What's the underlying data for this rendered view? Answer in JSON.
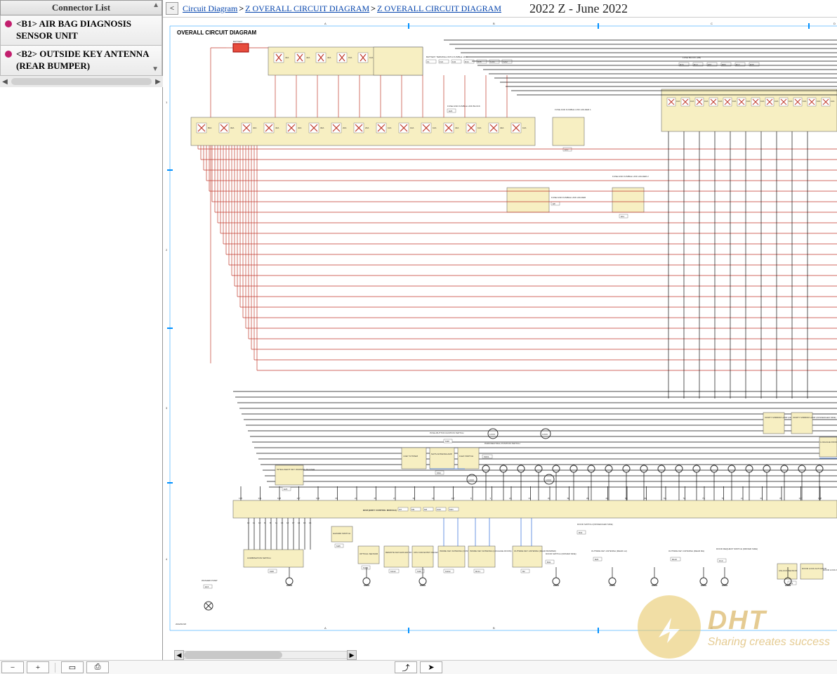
{
  "sidebar": {
    "header": "Connector List",
    "items": [
      {
        "code": "<B1>",
        "text": "AIR BAG DIAGNOSIS SENSOR UNIT"
      },
      {
        "code": "<B2>",
        "text": "OUTSIDE KEY ANTENNA (REAR BUMPER)"
      }
    ]
  },
  "breadcrumb": {
    "back": "<",
    "items": [
      "Circuit Diagram",
      "Z OVERALL CIRCUIT DIAGRAM",
      "Z OVERALL CIRCUIT DIAGRAM"
    ],
    "sep": ">"
  },
  "doc_title": "2022 Z - June 2022",
  "diagram": {
    "title": "OVERALL CIRCUIT DIAGRAM",
    "date": "2022/02/18",
    "grid_cols": [
      "A",
      "B",
      "C",
      "D"
    ],
    "grid_rows": [
      "1",
      "2",
      "3",
      "4"
    ],
    "battery_label": "BATTERY",
    "blocks": {
      "batt_terminal": {
        "label": "BATTERY TERMINAL WITH FUSIBLE LINK",
        "refs": [
          "F1",
          "F21",
          "F22",
          "R44",
          "R45",
          "F221",
          "F222"
        ]
      },
      "fuse_block_jb": {
        "label": "FUSE BLOCK (J/B)",
        "refs": [
          "R16",
          "R13",
          "E67",
          "R80",
          "R17",
          "R35"
        ]
      },
      "fuse_fusible_block": {
        "label": "FUSE AND FUSIBLE LINK BLOCK",
        "refs": [
          "E24"
        ]
      },
      "fuse_holder1": {
        "label": "FUSE AND FUSIBLE LINK HOLDER 1",
        "refs": [
          "E10"
        ]
      },
      "fuse_holder_a": {
        "label": "FUSE AND FUSIBLE LINK HOLDER",
        "refs": [
          "E8"
        ]
      },
      "fuse_holder2": {
        "label": "FUSE AND FUSIBLE LINK HOLDER 2",
        "refs": [
          "E11"
        ]
      },
      "ikey_warning": {
        "label": "INTELLIGENT KEY WARNING BUZZER",
        "refs": [
          "E23"
        ]
      },
      "ikey_system": {
        "label": "I-KEY SYSTEM",
        "refs": [
          "M36"
        ]
      },
      "nats_antenna": {
        "label": "NATS ANTENNA AMP.",
        "refs": [
          "M34"
        ]
      },
      "flexswitch": {
        "label": "FLEX SWITCH",
        "refs": [
          "M201"
        ]
      },
      "push_button": {
        "label": "PUSH-BUTTON IGNITION SWITCH",
        "refs": [
          "M38"
        ]
      },
      "park_neutral": {
        "label": "PARK/NEUTRAL POSITION SWITCH",
        "refs": [
          "E37"
        ]
      },
      "vanity_driver": {
        "label": "VANITY MIRROR LAMP (DRIVER SIDE)",
        "refs": [
          "R81"
        ]
      },
      "vanity_pass": {
        "label": "VANITY MIRROR LAMP (PASSENGER SIDE)",
        "refs": [
          "R82"
        ]
      },
      "luggage_lamp": {
        "label": "LUGGAGE ROOM LAMP",
        "refs": [
          "R41"
        ]
      },
      "bcm": {
        "label": "BCM (BODY CONTROL MODULE)",
        "refs": [
          "M7",
          "M9",
          "M6",
          "M19",
          "M21"
        ]
      },
      "door_sw_pass": {
        "label": "DOOR SWITCH (PASSENGER SIDE)",
        "refs": [
          "B33"
        ]
      },
      "hazard_switch": {
        "label": "HAZARD SWITCH",
        "refs": [
          "M45"
        ]
      },
      "combination_switch": {
        "label": "COMBINATION SWITCH",
        "refs": [
          "M28"
        ]
      },
      "washer_pump": {
        "label": "WASHER PUMP",
        "refs": [
          "E16"
        ]
      },
      "remote_keyless": {
        "label": "REMOTE KEYLESS ENTRY RECEIVER",
        "refs": [
          "M142"
        ]
      },
      "optical_sensor": {
        "label": "OPTICAL SENSOR",
        "refs": [
          "M112"
        ]
      },
      "cpu_rke": {
        "label": "CPU FOR ENTRY RECEIVER",
        "refs": [
          "M48"
        ]
      },
      "inside_key_console": {
        "label": "INSIDE KEY ANTENNA (CONSOLE)",
        "refs": [
          "M102"
        ]
      },
      "inside_key_luggage": {
        "label": "INSIDE KEY ANTENNA (LUGGAGE ROOM)",
        "refs": [
          "B131"
        ]
      },
      "outside_key_rear": {
        "label": "OUTSIDE KEY ANTENNA (REAR BUMPER)",
        "refs": [
          "B2"
        ]
      },
      "door_sw_driver": {
        "label": "DOOR SWITCH (DRIVER SIDE)",
        "refs": [
          "B34"
        ]
      },
      "outside_key_rearlh": {
        "label": "OUTSIDE KEY ANTENNA (REAR LH)",
        "refs": [
          "B26"
        ]
      },
      "outside_key_rearrh": {
        "label": "OUTSIDE KEY ANTENNA (REAR RH)",
        "refs": [
          "B120"
        ]
      },
      "door_request_driver": {
        "label": "DOOR REQUEST SWITCH (DRIVER SIDE)",
        "refs": [
          "D10"
        ]
      },
      "unlock_sensor": {
        "label": "UNLOCK SENSOR",
        "refs": [
          "D33"
        ]
      },
      "door_lock_actuator": {
        "label": "DOOR LOCK ACTUATOR",
        "refs": []
      },
      "door_lock_assembly": {
        "label": "DOOR LOCK ASSEMBLY",
        "refs": [
          "D11"
        ]
      }
    },
    "fuse_values_top": [
      "40A",
      "40A",
      "40A",
      "15A",
      "10A",
      "40A",
      "40A"
    ],
    "fuse_values_top2": [
      "10A",
      "40A"
    ],
    "fuse_values_jb": [
      "10A",
      "10A",
      "10A",
      "10A",
      "10A",
      "10A",
      "10A",
      "10A",
      "10A",
      "10A",
      "10A",
      "10A"
    ],
    "fuse_values_mid": [
      "80A",
      "30A",
      "40A",
      "40A",
      "40A",
      "30A",
      "20A",
      "20A",
      "10A",
      "10A",
      "10A",
      "40A",
      "10A",
      "40A",
      "10A"
    ],
    "bcm_pins_top": [
      "135",
      "131",
      "108",
      "107",
      "106",
      "68",
      "24",
      "25",
      "27",
      "38",
      "18",
      "107",
      "8",
      "3",
      "2A",
      "2C",
      "20",
      "3E",
      "2E",
      "2H",
      "6A",
      "6E",
      "6G",
      "7H",
      "7G",
      "7F",
      "2J",
      "20",
      "35",
      "137",
      "138"
    ],
    "bcm_pins_bot": [
      "12",
      "11",
      "10",
      "9",
      "8",
      "11",
      "16",
      "12",
      "17",
      "14",
      "15",
      "16"
    ],
    "lock_labels": [
      "LOCK",
      "LOCK",
      "LOCK",
      "LOCK"
    ]
  },
  "watermark": {
    "big": "DHT",
    "small": "Sharing creates success"
  },
  "toolbar": {
    "zoom_out": "−",
    "zoom_in": "+",
    "icons": [
      "page",
      "print",
      "jump",
      "pointer"
    ]
  }
}
